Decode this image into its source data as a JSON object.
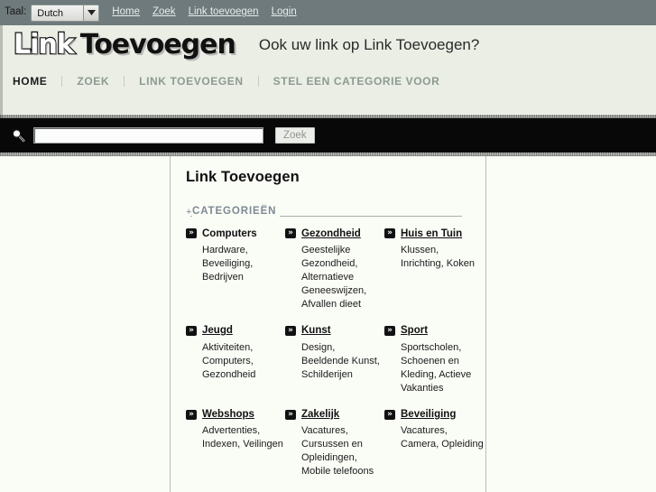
{
  "topbar": {
    "lang_label": "Taal:",
    "lang_value": "Dutch",
    "lang_options": [
      "Dutch"
    ],
    "links": [
      {
        "label": "Home"
      },
      {
        "label": "Zoek"
      },
      {
        "label": "Link toevoegen"
      },
      {
        "label": "Login"
      }
    ]
  },
  "branding": {
    "logo_part1": "Link",
    "logo_part2": "Toevoegen",
    "tagline": "Ook uw link op Link Toevoegen?"
  },
  "mainnav": {
    "items": [
      {
        "label": "HOME",
        "active": true
      },
      {
        "label": "ZOEK",
        "active": false
      },
      {
        "label": "LINK TOEVOEGEN",
        "active": false
      },
      {
        "label": "STEL EEN CATEGORIE VOOR",
        "active": false
      }
    ]
  },
  "search": {
    "icon": "magnifier-icon",
    "value": "",
    "placeholder": "",
    "button_label": "Zoek"
  },
  "main": {
    "title": "Link Toevoegen",
    "section_plus": "+",
    "section_title": "CATEGORIEËN",
    "categories": [
      {
        "name": "Computers",
        "underlined": false,
        "subs": "Hardware, Beveiliging, Bedrijven"
      },
      {
        "name": "Gezondheid",
        "underlined": true,
        "subs": "Geestelijke Gezondheid, Alternatieve Geneeswijzen, Afvallen dieet"
      },
      {
        "name": "Huis en Tuin",
        "underlined": true,
        "subs": "Klussen, Inrichting, Koken"
      },
      {
        "name": "Jeugd",
        "underlined": true,
        "subs": "Aktiviteiten, Computers, Gezondheid"
      },
      {
        "name": "Kunst",
        "underlined": true,
        "subs": "Design, Beeldende Kunst, Schilderijen"
      },
      {
        "name": "Sport",
        "underlined": true,
        "subs": "Sportscholen, Schoenen en Kleding, Actieve Vakanties"
      },
      {
        "name": "Webshops",
        "underlined": true,
        "subs": "Advertenties, Indexen, Veilingen"
      },
      {
        "name": "Zakelijk",
        "underlined": true,
        "subs": "Vacatures, Cursussen en Opleidingen, Mobile telefoons"
      },
      {
        "name": "Beveiliging",
        "underlined": true,
        "subs": "Vacatures, Camera, Opleiding"
      }
    ]
  },
  "colors": {
    "topbar_bg": "#6e7a7b",
    "band_bg": "#eaeee5",
    "searchbar_bg": "#080808",
    "page_bg": "#fafcf6",
    "accent_muted": "#7e8a93",
    "nav_inactive": "#8d9a92"
  }
}
